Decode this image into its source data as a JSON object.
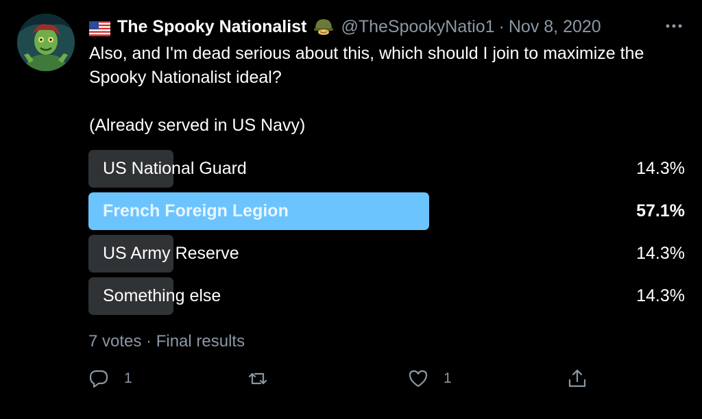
{
  "author": {
    "display_name": "The Spooky Nationalist",
    "handle": "@TheSpookyNatio1",
    "date": "Nov 8, 2020",
    "separator": "·",
    "flag_icon": "us-flag-icon",
    "badge_icon": "military-helmet-icon"
  },
  "tweet": {
    "line1": "Also, and I'm dead serious about this, which should I join to maximize the Spooky Nationalist ideal?",
    "line2": "(Already served in US Navy)"
  },
  "poll": {
    "options": [
      {
        "label": "US National Guard",
        "percent": "14.3%",
        "fraction": 0.143
      },
      {
        "label": "French Foreign Legion",
        "percent": "57.1%",
        "fraction": 0.571
      },
      {
        "label": "US Army Reserve",
        "percent": "14.3%",
        "fraction": 0.143
      },
      {
        "label": "Something else",
        "percent": "14.3%",
        "fraction": 0.143
      }
    ],
    "votes": "7 votes",
    "status": "Final results",
    "meta_separator": " · "
  },
  "actions": {
    "reply_count": "1",
    "retweet_count": "",
    "like_count": "1"
  },
  "colors": {
    "background": "#000000",
    "winner_bar": "#6cc4ff",
    "other_bar": "#2f3336",
    "secondary_text": "#8b98a5"
  }
}
